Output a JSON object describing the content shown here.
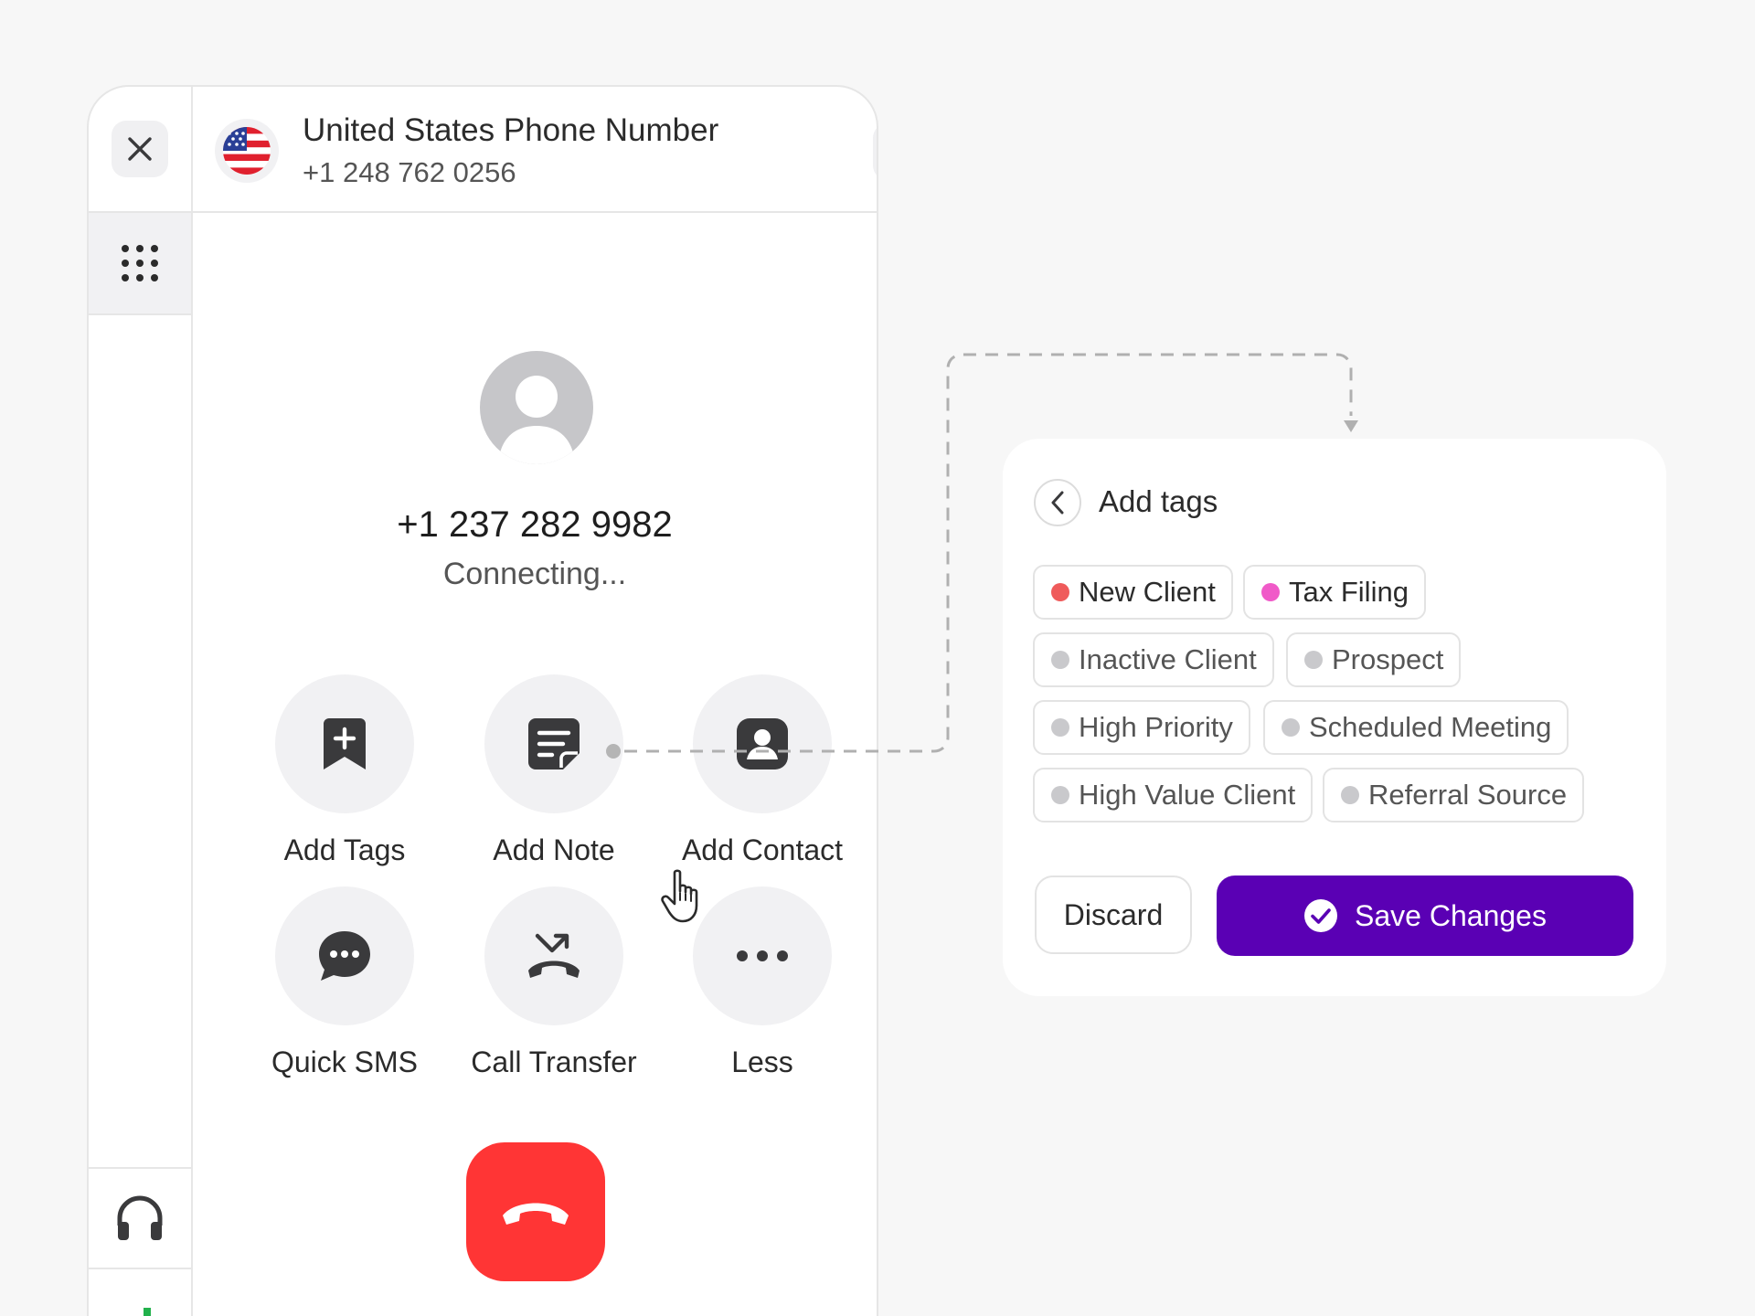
{
  "dialer": {
    "line": {
      "title": "United States Phone Number",
      "number": "+1 248 762 0256",
      "flag_icon": "us-flag-icon"
    },
    "call": {
      "number": "+1 237 282 9982",
      "status": "Connecting..."
    },
    "actions": [
      {
        "label": "Add Tags",
        "icon": "bookmark-plus-icon"
      },
      {
        "label": "Add Note",
        "icon": "note-icon"
      },
      {
        "label": "Add Contact",
        "icon": "contact-icon"
      },
      {
        "label": "Quick SMS",
        "icon": "chat-bubble-icon"
      },
      {
        "label": "Call Transfer",
        "icon": "call-transfer-icon"
      },
      {
        "label": "Less",
        "icon": "more-dots-icon"
      }
    ],
    "rail_icons": [
      "close-icon",
      "keypad-icon",
      "headset-icon",
      "stats-icon"
    ]
  },
  "tags_panel": {
    "title": "Add tags",
    "tags": [
      {
        "label": "New Client",
        "color": "#ef5b5b"
      },
      {
        "label": "Tax Filing",
        "color": "#f05ac8"
      },
      {
        "label": "Inactive Client",
        "color": "#c9c9cc"
      },
      {
        "label": "Prospect",
        "color": "#c9c9cc"
      },
      {
        "label": "High Priority",
        "color": "#c9c9cc"
      },
      {
        "label": "Scheduled Meeting",
        "color": "#c9c9cc"
      },
      {
        "label": "High Value Client",
        "color": "#c9c9cc"
      },
      {
        "label": "Referral Source",
        "color": "#c9c9cc"
      }
    ],
    "discard_label": "Discard",
    "save_label": "Save Changes"
  },
  "colors": {
    "primary": "#5a00b4",
    "hangup": "#ff3535",
    "icon_dark": "#3a3a3c",
    "surface": "#f1f1f3"
  }
}
